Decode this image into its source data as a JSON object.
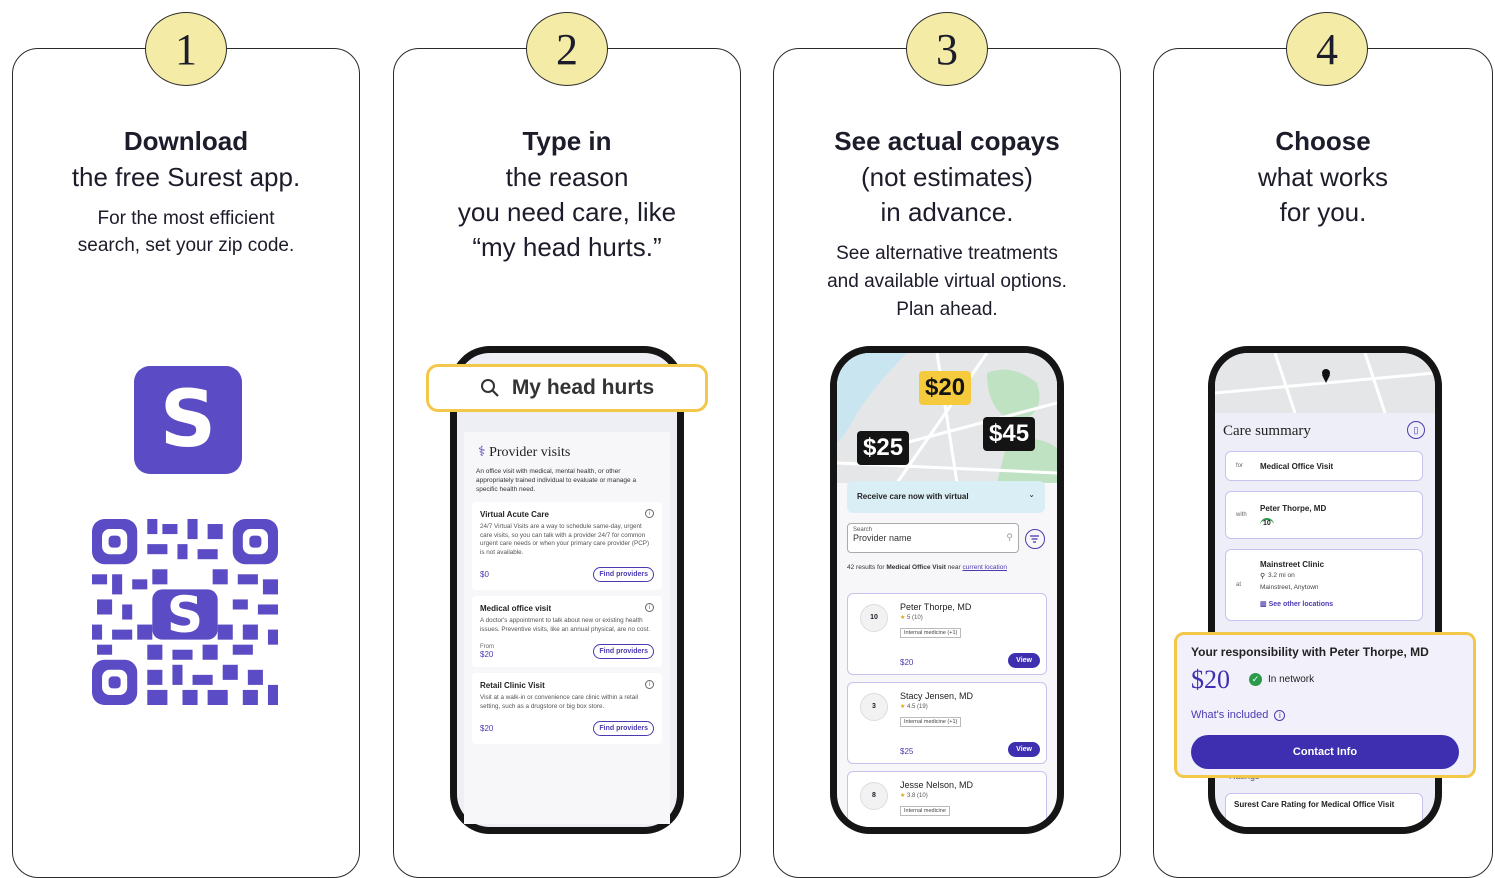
{
  "steps": [
    {
      "number": "1",
      "title": "Download",
      "subtitle_lines": [
        "the free Surest app."
      ],
      "detail_lines": [
        "For the most efficient",
        "search, set your zip code."
      ]
    },
    {
      "number": "2",
      "title": "Type in",
      "subtitle_lines": [
        "the reason",
        "you need care, like",
        "“my head hurts.”"
      ],
      "detail_lines": []
    },
    {
      "number": "3",
      "title": "See actual copays",
      "subtitle_lines": [
        "(not estimates)",
        "in advance."
      ],
      "detail_lines": [
        "See alternative treatments",
        "and available virtual options.",
        "Plan ahead."
      ]
    },
    {
      "number": "4",
      "title": "Choose",
      "subtitle_lines": [
        "what works",
        "for you."
      ],
      "detail_lines": []
    }
  ],
  "step1": {
    "logo_letter": "S",
    "icon": "surest-app-icon",
    "qr_icon": "qr-code-icon",
    "brand_color": "#5b4bc4"
  },
  "step2": {
    "search_text": "My head hurts",
    "section_title": "Provider visits",
    "section_desc": "An office visit with medical, mental health, or other appropriately trained individual to evaluate or manage a specific health need.",
    "options": [
      {
        "title": "Virtual Acute Care",
        "desc": "24/7 Virtual Visits are a way to schedule same-day, urgent care visits, so you can talk with a provider 24/7 for common urgent care needs or when your primary care provider (PCP) is not available.",
        "price_prefix": "",
        "price": "$0",
        "button": "Find providers"
      },
      {
        "title": "Medical office visit",
        "desc": "A doctor's appointment to talk about new or existing health issues. Preventive visits, like an annual physical, are no cost.",
        "price_prefix": "From",
        "price": "$20",
        "button": "Find providers"
      },
      {
        "title": "Retail Clinic Visit",
        "desc": "Visit at a walk-in or convenience care clinic within a retail setting, such as a drugstore or big box store.",
        "price_prefix": "",
        "price": "$20",
        "button": "Find providers"
      }
    ]
  },
  "step3": {
    "map_prices": [
      "$20",
      "$25",
      "$45"
    ],
    "virtual_banner": "Receive care now with virtual",
    "search_label": "Search",
    "search_placeholder": "Provider name",
    "results_text": "42 results for",
    "results_bold": "Medical Office Visit",
    "results_near": "near",
    "results_link": "current location",
    "doctors": [
      {
        "name": "Peter Thorpe, MD",
        "rating": "5 (10)",
        "gauge": "10",
        "tag": "Internal medicine (+1)",
        "price": "$20",
        "button": "View"
      },
      {
        "name": "Stacy Jensen, MD",
        "rating": "4.5 (19)",
        "gauge": "3",
        "tag": "Internal medicine (+1)",
        "price": "$25",
        "button": "View"
      },
      {
        "name": "Jesse Nelson, MD",
        "rating": "3.8 (10)",
        "gauge": "8",
        "tag": "Internal medicine",
        "price": "",
        "button": ""
      }
    ]
  },
  "step4": {
    "summary_title": "Care summary",
    "for_label": "for",
    "for_value": "Medical Office Visit",
    "with_label": "with",
    "with_value": "Peter Thorpe, MD",
    "with_gauge": "10",
    "at_label": "at",
    "at_value": "Mainstreet Clinic",
    "at_distance": "3.2 mi on",
    "at_address": "Mainstreet, Anytown",
    "other_locations": "See other locations",
    "responsibility": "Your responsibility with Peter Thorpe, MD",
    "price": "$20",
    "network": "In network",
    "included": "What's included",
    "contact": "Contact Info",
    "rating_title": "Surest Care Rating for Medical Office Visit",
    "ratings_label": "Ratings"
  }
}
